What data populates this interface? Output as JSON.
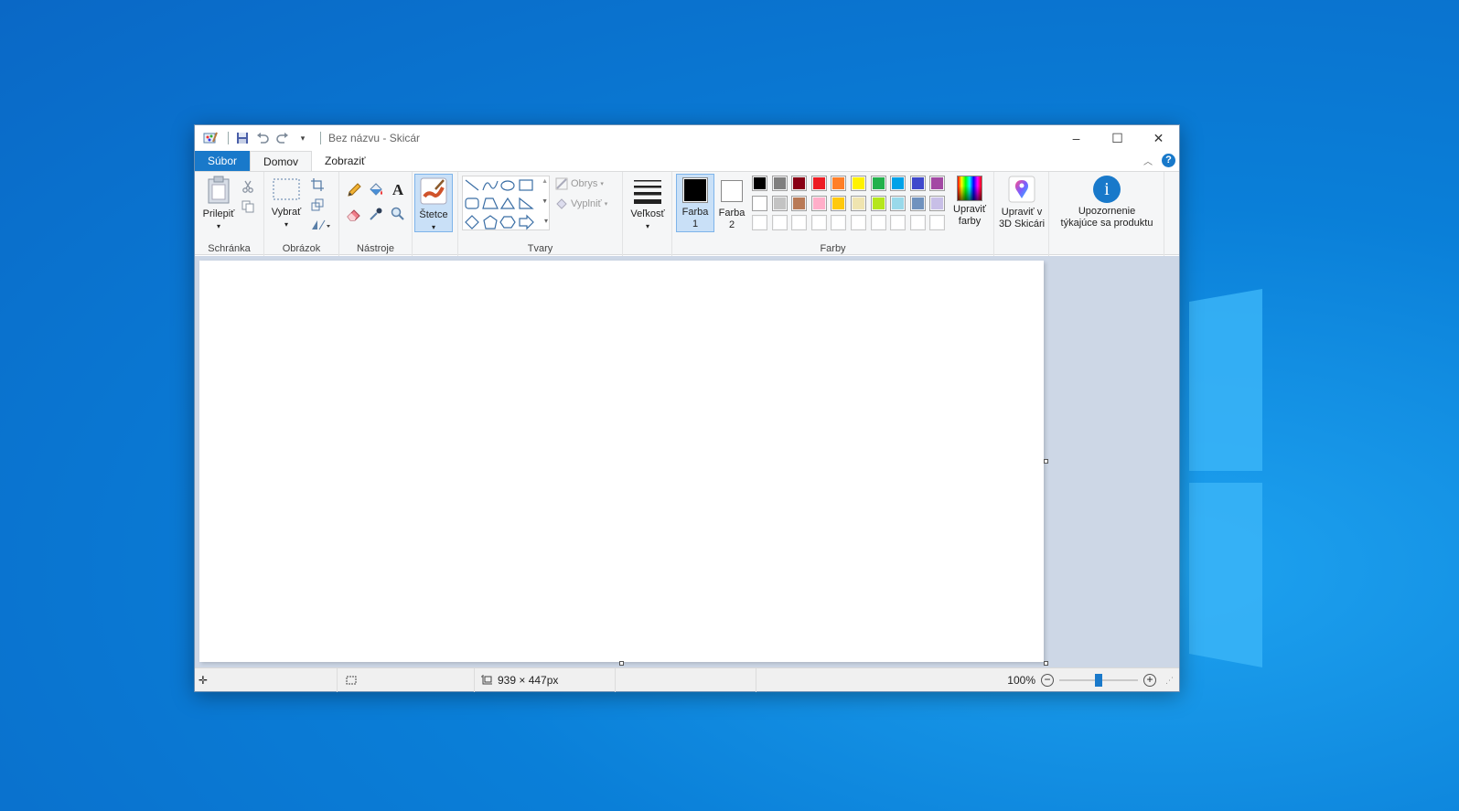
{
  "window": {
    "title": "Bez názvu - Skicár"
  },
  "tabs": {
    "file": "Súbor",
    "home": "Domov",
    "view": "Zobraziť"
  },
  "ribbon": {
    "clipboard": {
      "paste": "Prilepiť",
      "group": "Schránka"
    },
    "image": {
      "select": "Vybrať",
      "group": "Obrázok"
    },
    "tools": {
      "group": "Nástroje"
    },
    "brushes": {
      "label": "Štetce"
    },
    "shapes": {
      "outline": "Obrys",
      "fill": "Vyplniť",
      "group": "Tvary"
    },
    "size": {
      "label": "Veľkosť"
    },
    "colors": {
      "color1_line1": "Farba",
      "color1_line2": "1",
      "color2_line1": "Farba",
      "color2_line2": "2",
      "edit_line1": "Upraviť",
      "edit_line2": "farby",
      "group": "Farby",
      "palette_row1": [
        "#000000",
        "#7f7f7f",
        "#880015",
        "#ed1c24",
        "#ff7f27",
        "#fff200",
        "#22b14c",
        "#00a2e8",
        "#3f48cc",
        "#a349a4"
      ],
      "palette_row2": [
        "#ffffff",
        "#c3c3c3",
        "#b97a57",
        "#ffaec9",
        "#ffc90e",
        "#efe4b0",
        "#b5e61d",
        "#99d9ea",
        "#7092be",
        "#c8bfe7"
      ],
      "palette_row3": [
        "#ffffff",
        "#ffffff",
        "#ffffff",
        "#ffffff",
        "#ffffff",
        "#ffffff",
        "#ffffff",
        "#ffffff",
        "#ffffff",
        "#ffffff"
      ]
    },
    "paint3d": {
      "line1": "Upraviť v",
      "line2": "3D Skicári"
    },
    "notice": {
      "line1": "Upozornenie",
      "line2": "týkajúce sa produktu"
    }
  },
  "status": {
    "image_size": "939 × 447px",
    "zoom": "100%",
    "zoom_fraction": 0.5
  }
}
